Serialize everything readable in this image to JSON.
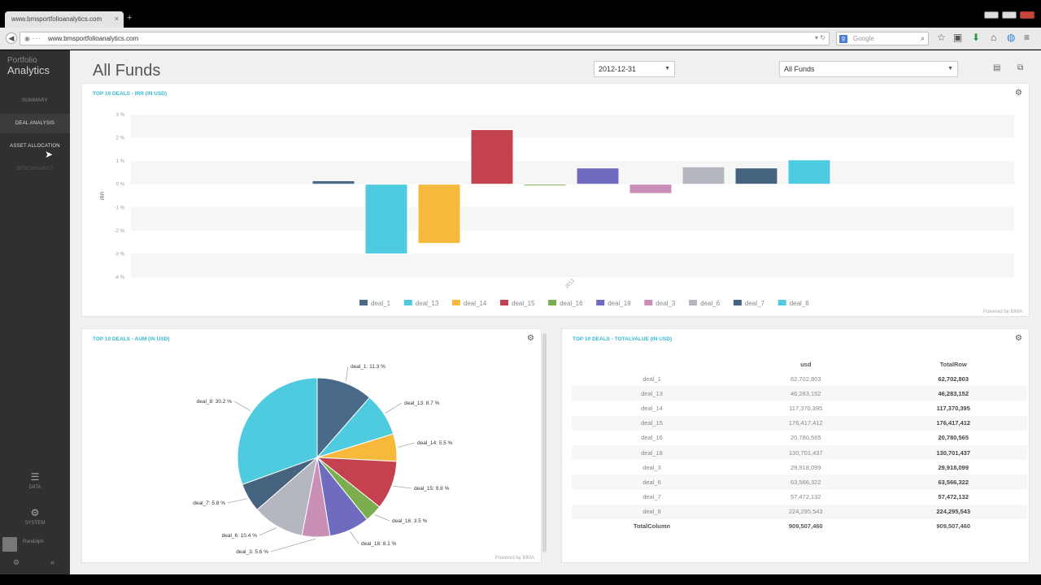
{
  "browser": {
    "tab_title": "www.bmsportfolioanalytics.com",
    "tab_close": "×",
    "new_tab": "+",
    "url": "www.bmsportfolioanalytics.com",
    "search_placeholder": "Google",
    "search_engine": "g"
  },
  "sidebar": {
    "brand_top": "Portfolio",
    "brand_main": "Analytics",
    "items": [
      {
        "label": "SUMMARY"
      },
      {
        "label": "DEAL ANALYSIS"
      },
      {
        "label": "ASSET ALLOCATION"
      },
      {
        "label": "BENCHMARKS"
      }
    ],
    "bottom": [
      {
        "label": "DATA",
        "icon": "☰"
      },
      {
        "label": "SYSTEM",
        "icon": "⚙"
      }
    ],
    "user_name": "Randolph"
  },
  "header": {
    "title": "All Funds",
    "date_select": "2012-12-31",
    "fund_select": "All Funds"
  },
  "panels": {
    "irr_title": "TOP 10 DEALS - IRR (IN USD)",
    "aum_title": "TOP 10 DEALS - AUM (IN USD)",
    "tv_title": "TOP 10 DEALS - TOTALVALUE (IN USD)",
    "powered": "Powered by BIMA"
  },
  "chart_data": [
    {
      "type": "bar",
      "title": "TOP 10 DEALS - IRR (IN USD)",
      "ylabel": "IRR",
      "ylim": [
        -4,
        3
      ],
      "yticks": [
        "3 %",
        "2 %",
        "1 %",
        "0 %",
        "-1 %",
        "-2 %",
        "-3 %",
        "-4 %"
      ],
      "x_tick": "2012",
      "grid": true,
      "legend_position": "bottom",
      "categories": [
        "deal_1",
        "deal_13",
        "deal_14",
        "deal_15",
        "deal_16",
        "deal_18",
        "deal_3",
        "deal_6",
        "deal_7",
        "deal_8"
      ],
      "values": [
        0.15,
        -3.0,
        -2.55,
        2.35,
        -0.05,
        0.7,
        -0.4,
        0.75,
        0.7,
        1.05
      ],
      "colors": [
        "#4a6a8a",
        "#4ecbdf",
        "#f6b93b",
        "#c4424f",
        "#7cae4f",
        "#6f6bbf",
        "#c98fb6",
        "#b4b7bf",
        "#45627f",
        "#4ecbdf"
      ]
    },
    {
      "type": "pie",
      "title": "TOP 10 DEALS - AUM (IN USD)",
      "labels": [
        "deal_1",
        "deal_13",
        "deal_14",
        "deal_15",
        "deal_16",
        "deal_18",
        "deal_3",
        "deal_6",
        "deal_7",
        "deal_8"
      ],
      "label_text": [
        "deal_1: 11.3 %",
        "deal_13: 8.7 %",
        "deal_14: 5.5 %",
        "deal_15: 9.8 %",
        "deal_16: 3.5 %",
        "deal_18: 8.1 %",
        "deal_3: 5.6 %",
        "deal_6: 10.4 %",
        "deal_7: 5.8 %",
        "deal_8: 30.2 %"
      ],
      "values": [
        11.3,
        8.7,
        5.5,
        9.8,
        3.5,
        8.1,
        5.6,
        10.4,
        5.8,
        30.2
      ],
      "colors": [
        "#4a6a8a",
        "#4ecbdf",
        "#f6b93b",
        "#c4424f",
        "#7cae4f",
        "#6f6bbf",
        "#c98fb6",
        "#b4b7bf",
        "#45627f",
        "#4ecbdf"
      ]
    },
    {
      "type": "table",
      "title": "TOP 10 DEALS - TOTALVALUE (IN USD)",
      "columns": [
        "",
        "usd",
        "TotalRow"
      ],
      "rows": [
        [
          "deal_1",
          "62,702,803",
          "62,702,803"
        ],
        [
          "deal_13",
          "46,283,152",
          "46,283,152"
        ],
        [
          "deal_14",
          "117,370,395",
          "117,370,395"
        ],
        [
          "deal_15",
          "176,417,412",
          "176,417,412"
        ],
        [
          "deal_16",
          "20,780,565",
          "20,780,565"
        ],
        [
          "deal_18",
          "130,701,437",
          "130,701,437"
        ],
        [
          "deal_3",
          "29,918,099",
          "29,918,099"
        ],
        [
          "deal_6",
          "63,566,322",
          "63,566,322"
        ],
        [
          "deal_7",
          "57,472,132",
          "57,472,132"
        ],
        [
          "deal_8",
          "224,295,543",
          "224,295,543"
        ],
        [
          "TotalColumn",
          "909,507,460",
          "909,507,460"
        ]
      ]
    }
  ]
}
